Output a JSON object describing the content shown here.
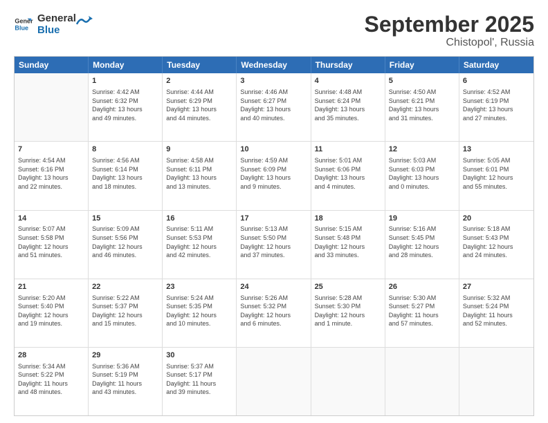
{
  "logo": {
    "line1": "General",
    "line2": "Blue"
  },
  "title": "September 2025",
  "subtitle": "Chistopol', Russia",
  "weekdays": [
    "Sunday",
    "Monday",
    "Tuesday",
    "Wednesday",
    "Thursday",
    "Friday",
    "Saturday"
  ],
  "weeks": [
    [
      {
        "day": "",
        "detail": ""
      },
      {
        "day": "1",
        "detail": "Sunrise: 4:42 AM\nSunset: 6:32 PM\nDaylight: 13 hours\nand 49 minutes."
      },
      {
        "day": "2",
        "detail": "Sunrise: 4:44 AM\nSunset: 6:29 PM\nDaylight: 13 hours\nand 44 minutes."
      },
      {
        "day": "3",
        "detail": "Sunrise: 4:46 AM\nSunset: 6:27 PM\nDaylight: 13 hours\nand 40 minutes."
      },
      {
        "day": "4",
        "detail": "Sunrise: 4:48 AM\nSunset: 6:24 PM\nDaylight: 13 hours\nand 35 minutes."
      },
      {
        "day": "5",
        "detail": "Sunrise: 4:50 AM\nSunset: 6:21 PM\nDaylight: 13 hours\nand 31 minutes."
      },
      {
        "day": "6",
        "detail": "Sunrise: 4:52 AM\nSunset: 6:19 PM\nDaylight: 13 hours\nand 27 minutes."
      }
    ],
    [
      {
        "day": "7",
        "detail": "Sunrise: 4:54 AM\nSunset: 6:16 PM\nDaylight: 13 hours\nand 22 minutes."
      },
      {
        "day": "8",
        "detail": "Sunrise: 4:56 AM\nSunset: 6:14 PM\nDaylight: 13 hours\nand 18 minutes."
      },
      {
        "day": "9",
        "detail": "Sunrise: 4:58 AM\nSunset: 6:11 PM\nDaylight: 13 hours\nand 13 minutes."
      },
      {
        "day": "10",
        "detail": "Sunrise: 4:59 AM\nSunset: 6:09 PM\nDaylight: 13 hours\nand 9 minutes."
      },
      {
        "day": "11",
        "detail": "Sunrise: 5:01 AM\nSunset: 6:06 PM\nDaylight: 13 hours\nand 4 minutes."
      },
      {
        "day": "12",
        "detail": "Sunrise: 5:03 AM\nSunset: 6:03 PM\nDaylight: 13 hours\nand 0 minutes."
      },
      {
        "day": "13",
        "detail": "Sunrise: 5:05 AM\nSunset: 6:01 PM\nDaylight: 12 hours\nand 55 minutes."
      }
    ],
    [
      {
        "day": "14",
        "detail": "Sunrise: 5:07 AM\nSunset: 5:58 PM\nDaylight: 12 hours\nand 51 minutes."
      },
      {
        "day": "15",
        "detail": "Sunrise: 5:09 AM\nSunset: 5:56 PM\nDaylight: 12 hours\nand 46 minutes."
      },
      {
        "day": "16",
        "detail": "Sunrise: 5:11 AM\nSunset: 5:53 PM\nDaylight: 12 hours\nand 42 minutes."
      },
      {
        "day": "17",
        "detail": "Sunrise: 5:13 AM\nSunset: 5:50 PM\nDaylight: 12 hours\nand 37 minutes."
      },
      {
        "day": "18",
        "detail": "Sunrise: 5:15 AM\nSunset: 5:48 PM\nDaylight: 12 hours\nand 33 minutes."
      },
      {
        "day": "19",
        "detail": "Sunrise: 5:16 AM\nSunset: 5:45 PM\nDaylight: 12 hours\nand 28 minutes."
      },
      {
        "day": "20",
        "detail": "Sunrise: 5:18 AM\nSunset: 5:43 PM\nDaylight: 12 hours\nand 24 minutes."
      }
    ],
    [
      {
        "day": "21",
        "detail": "Sunrise: 5:20 AM\nSunset: 5:40 PM\nDaylight: 12 hours\nand 19 minutes."
      },
      {
        "day": "22",
        "detail": "Sunrise: 5:22 AM\nSunset: 5:37 PM\nDaylight: 12 hours\nand 15 minutes."
      },
      {
        "day": "23",
        "detail": "Sunrise: 5:24 AM\nSunset: 5:35 PM\nDaylight: 12 hours\nand 10 minutes."
      },
      {
        "day": "24",
        "detail": "Sunrise: 5:26 AM\nSunset: 5:32 PM\nDaylight: 12 hours\nand 6 minutes."
      },
      {
        "day": "25",
        "detail": "Sunrise: 5:28 AM\nSunset: 5:30 PM\nDaylight: 12 hours\nand 1 minute."
      },
      {
        "day": "26",
        "detail": "Sunrise: 5:30 AM\nSunset: 5:27 PM\nDaylight: 11 hours\nand 57 minutes."
      },
      {
        "day": "27",
        "detail": "Sunrise: 5:32 AM\nSunset: 5:24 PM\nDaylight: 11 hours\nand 52 minutes."
      }
    ],
    [
      {
        "day": "28",
        "detail": "Sunrise: 5:34 AM\nSunset: 5:22 PM\nDaylight: 11 hours\nand 48 minutes."
      },
      {
        "day": "29",
        "detail": "Sunrise: 5:36 AM\nSunset: 5:19 PM\nDaylight: 11 hours\nand 43 minutes."
      },
      {
        "day": "30",
        "detail": "Sunrise: 5:37 AM\nSunset: 5:17 PM\nDaylight: 11 hours\nand 39 minutes."
      },
      {
        "day": "",
        "detail": ""
      },
      {
        "day": "",
        "detail": ""
      },
      {
        "day": "",
        "detail": ""
      },
      {
        "day": "",
        "detail": ""
      }
    ]
  ]
}
